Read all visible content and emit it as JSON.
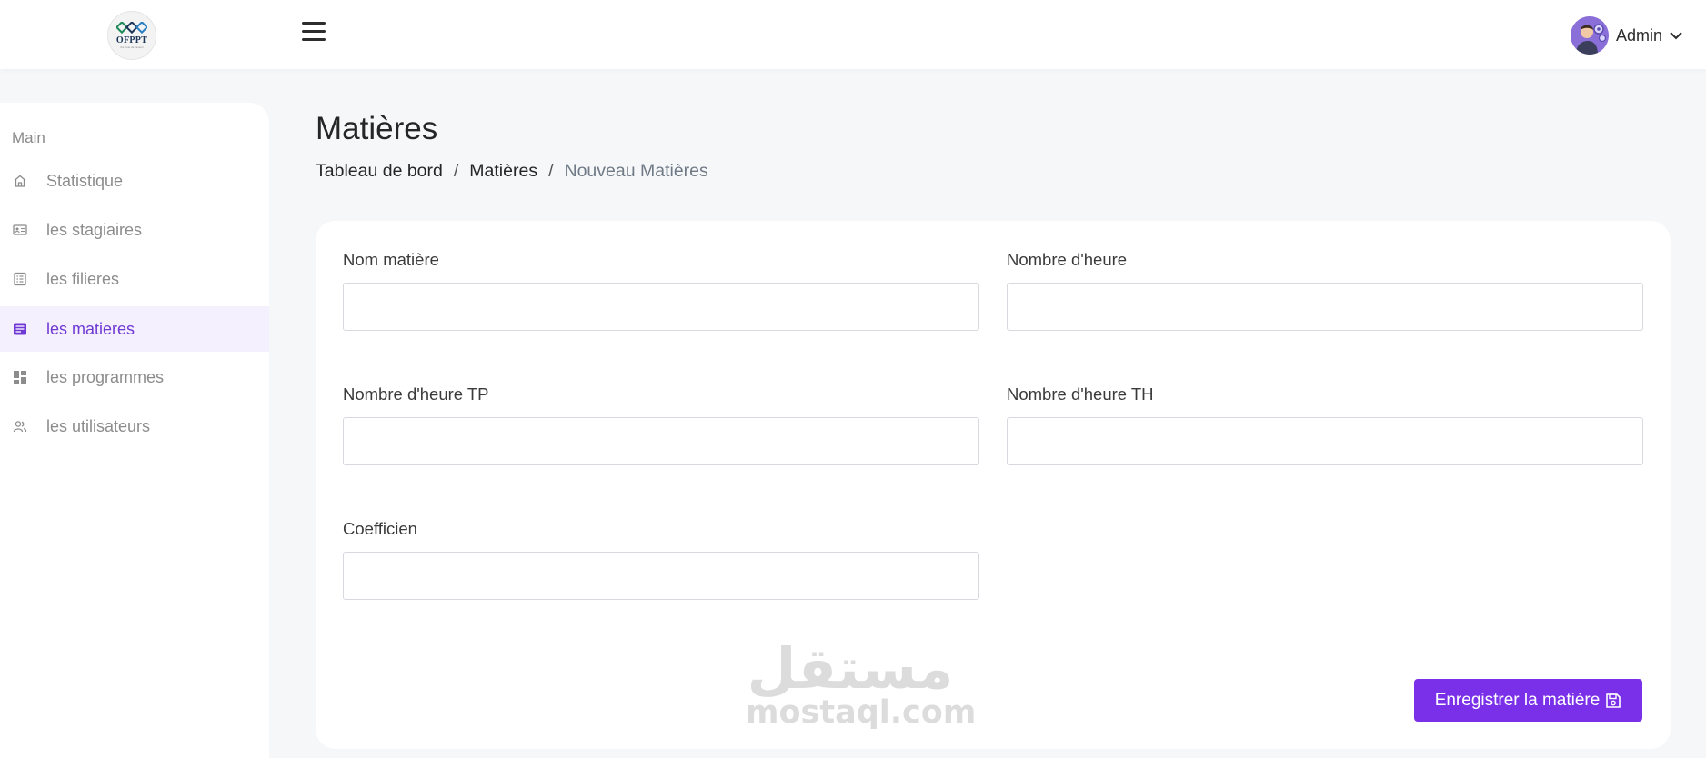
{
  "header": {
    "logo_text": "OFPPT",
    "logo_subtext": "the Pole de l'avenir",
    "user_name": "Admin"
  },
  "sidebar": {
    "section": "Main",
    "items": [
      {
        "label": "Statistique",
        "icon": "home-icon",
        "active": false
      },
      {
        "label": "les stagiaires",
        "icon": "id-card-icon",
        "active": false
      },
      {
        "label": "les filieres",
        "icon": "list-icon",
        "active": false
      },
      {
        "label": "les matieres",
        "icon": "document-icon",
        "active": true
      },
      {
        "label": "les programmes",
        "icon": "dashboard-icon",
        "active": false
      },
      {
        "label": "les utilisateurs",
        "icon": "users-icon",
        "active": false
      }
    ]
  },
  "main": {
    "title": "Matières",
    "breadcrumb": [
      "Tableau de bord",
      "Matières",
      "Nouveau Matières"
    ],
    "form": {
      "fields": [
        {
          "label": "Nom matière",
          "value": "",
          "placeholder": ""
        },
        {
          "label": "Nombre d'heure",
          "value": "",
          "placeholder": ""
        },
        {
          "label": "Nombre d'heure TP",
          "value": "",
          "placeholder": ""
        },
        {
          "label": "Nombre d'heure TH",
          "value": "",
          "placeholder": ""
        },
        {
          "label": "Coefficien",
          "value": "",
          "placeholder": ""
        }
      ],
      "submit_label": "Enregistrer la matière",
      "submit_icon": "save-icon"
    }
  },
  "watermark": {
    "arabic": "مستقل",
    "latin": "mostaql.com"
  },
  "colors": {
    "accent": "#7a30e8",
    "active_nav_text": "#6f3ad4",
    "active_nav_bg": "#f5f0fd",
    "background": "#f6f7f9"
  }
}
